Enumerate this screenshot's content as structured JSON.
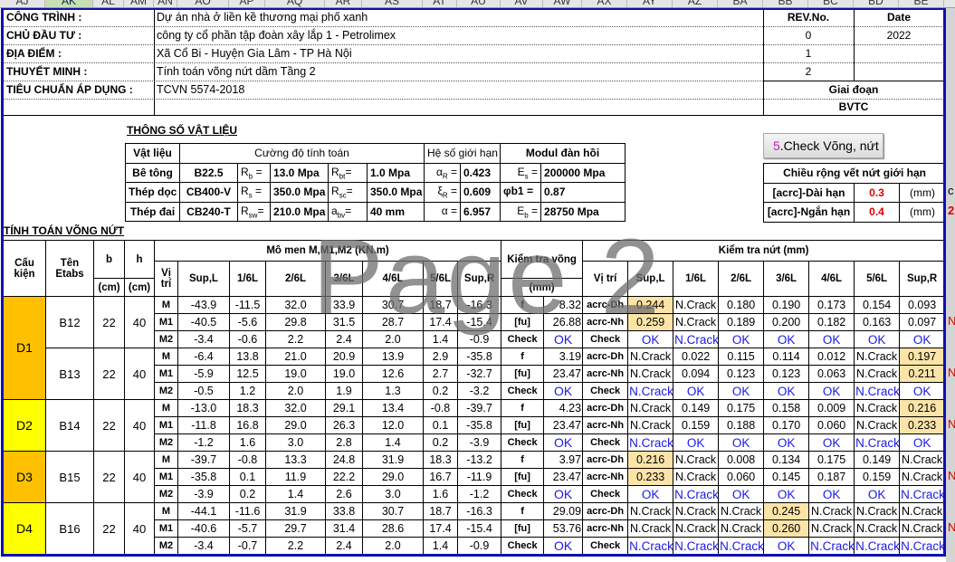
{
  "columns": [
    "AJ",
    "AK",
    "AL",
    "AM",
    "AN",
    "AO",
    "AP",
    "AQ",
    "AR",
    "AS",
    "AT",
    "AU",
    "AV",
    "AW",
    "AX",
    "AY",
    "AZ",
    "BA",
    "BB",
    "BC",
    "BD",
    "BE"
  ],
  "selected_column": "AK",
  "info": [
    {
      "label": "CÔNG TRÌNH :",
      "value": "Dự án nhà ở liền kề thương mại phố xanh"
    },
    {
      "label": "CHỦ ĐẦU TƯ :",
      "value": "công ty cổ phần tập đoàn xây lắp 1 - Petrolimex"
    },
    {
      "label": "ĐỊA ĐIỂM :",
      "value": "Xã Cổ Bi - Huyện Gia Lâm - TP Hà Nội"
    },
    {
      "label": "THUYẾT MINH :",
      "value": "Tính toán võng nứt dầm Tầng 2"
    },
    {
      "label": "TIÊU CHUẨN ÁP DỤNG :",
      "value": "TCVN 5574-2018"
    }
  ],
  "revision": {
    "rev_header": "REV.No.",
    "date_header": "Date",
    "rows": [
      {
        "rev": "0",
        "date": "2022"
      },
      {
        "rev": "1",
        "date": ""
      },
      {
        "rev": "2",
        "date": ""
      }
    ],
    "stage_label": "Giai đoạn",
    "stage_value": "BVTC"
  },
  "materials": {
    "title": "THÔNG SỐ VẬT LIỆU",
    "headers": {
      "material": "Vật liệu",
      "strength": "Cường độ tính toán",
      "limit": "Hệ số giới hạn",
      "modulus": "Modul đàn hồi"
    },
    "rows": [
      {
        "name": "Bê tông",
        "grade": "B22.5",
        "s1": "R",
        "s1sub": "b",
        "s1eq": " =",
        "v1": "13.0 Mpa",
        "s2": "R",
        "s2sub": "bt",
        "s2eq": "=",
        "v2": "1.0 Mpa",
        "k": "α",
        "ksub": "R",
        "keq": " =",
        "kv": "0.423",
        "e": "E",
        "esub": "s",
        "eeq": " =",
        "ev": "200000 Mpa"
      },
      {
        "name": "Thép  dọc",
        "grade": "CB400-V",
        "s1": "R",
        "s1sub": "s",
        "s1eq": " =",
        "v1": "350.0 Mpa",
        "s2": "R",
        "s2sub": "sc",
        "s2eq": "=",
        "v2": "350.0 Mpa",
        "k": "ξ",
        "ksub": "R",
        "keq": " =",
        "kv": "0.609",
        "e": "φb1 =",
        "esub": "",
        "eeq": "",
        "ev": "0.87"
      },
      {
        "name": "Thép đai",
        "grade": "CB240-T",
        "s1": "R",
        "s1sub": "sw",
        "s1eq": "=",
        "v1": "210.0 Mpa",
        "s2": "a",
        "s2sub": "bv",
        "s2eq": "=",
        "v2": "40 mm",
        "k": "α",
        "ksub": "",
        "keq": " =",
        "kv": "6.957",
        "e": "E",
        "esub": "b",
        "eeq": " =",
        "ev": "28750 Mpa"
      }
    ]
  },
  "check_button": {
    "number": "5",
    "label": ".Check Võng, nứt"
  },
  "crack_limit": {
    "title": "Chiều rộng vết nứt giới hạn",
    "rows": [
      {
        "label": "[acrc]-Dài hạn",
        "value": "0.3",
        "unit": "(mm)"
      },
      {
        "label": "[acrc]-Ngắn hạn",
        "value": "0.4",
        "unit": "(mm)"
      }
    ],
    "overflow": [
      "c",
      "2I"
    ]
  },
  "calc": {
    "title": "TÍNH TOÁN VÕNG NỨT",
    "headers": {
      "member": "Cấu kiện",
      "etabs": "Tên Etabs",
      "b": "b",
      "h": "h",
      "unit_cm": "(cm)",
      "moment": "Mô men M,M1,M2 (KN.m)",
      "position": "Vị trí",
      "deflection": "Kiểm tra võng",
      "unit_mm": "(mm)",
      "crack": "Kiểm tra nứt (mm)",
      "crack_position": "Vị trí",
      "stations": [
        "Sup,L",
        "1/6L",
        "2/6L",
        "3/6L",
        "4/6L",
        "5/6L",
        "Sup,R"
      ]
    },
    "moment_rows": [
      "M",
      "M1",
      "M2"
    ],
    "deflection_labels": [
      "f",
      "[fu]",
      "Check"
    ],
    "crack_rows": [
      "acrc-Dh",
      "acrc-Nh",
      "Check"
    ],
    "overflow_mark": "N",
    "members": [
      {
        "member": "D1",
        "color": "#ffc000",
        "beams": [
          {
            "name": "B12",
            "b": "22",
            "h": "40",
            "moments": [
              [
                "-43.9",
                "-11.5",
                "32.0",
                "33.9",
                "30.7",
                "18.7",
                "-16.3"
              ],
              [
                "-40.5",
                "-5.6",
                "29.8",
                "31.5",
                "28.7",
                "17.4",
                "-15.4"
              ],
              [
                "-3.4",
                "-0.6",
                "2.2",
                "2.4",
                "2.0",
                "1.4",
                "-0.9"
              ]
            ],
            "deflection": [
              "8.32",
              "26.88",
              "OK"
            ],
            "crack": [
              [
                "0.244",
                "N.Crack",
                "0.180",
                "0.190",
                "0.173",
                "0.154",
                "0.093"
              ],
              [
                "0.259",
                "N.Crack",
                "0.189",
                "0.200",
                "0.182",
                "0.163",
                "0.097"
              ],
              [
                "OK",
                "N.Crack",
                "OK",
                "OK",
                "OK",
                "OK",
                "OK"
              ]
            ],
            "highlight": [
              0
            ]
          },
          {
            "name": "B13",
            "b": "22",
            "h": "40",
            "moments": [
              [
                "-6.4",
                "13.8",
                "21.0",
                "20.9",
                "13.9",
                "2.9",
                "-35.8"
              ],
              [
                "-5.9",
                "12.5",
                "19.0",
                "19.0",
                "12.6",
                "2.7",
                "-32.7"
              ],
              [
                "-0.5",
                "1.2",
                "2.0",
                "1.9",
                "1.3",
                "0.2",
                "-3.2"
              ]
            ],
            "deflection": [
              "3.19",
              "23.47",
              "OK"
            ],
            "crack": [
              [
                "N.Crack",
                "0.022",
                "0.115",
                "0.114",
                "0.012",
                "N.Crack",
                "0.197"
              ],
              [
                "N.Crack",
                "0.094",
                "0.123",
                "0.123",
                "0.063",
                "N.Crack",
                "0.211"
              ],
              [
                "N.Crack",
                "OK",
                "OK",
                "OK",
                "OK",
                "N.Crack",
                "OK"
              ]
            ],
            "highlight": [
              6
            ]
          }
        ]
      },
      {
        "member": "D2",
        "color": "#ffff00",
        "beams": [
          {
            "name": "B14",
            "b": "22",
            "h": "40",
            "moments": [
              [
                "-13.0",
                "18.3",
                "32.0",
                "29.1",
                "13.4",
                "-0.8",
                "-39.7"
              ],
              [
                "-11.8",
                "16.8",
                "29.0",
                "26.3",
                "12.0",
                "0.1",
                "-35.8"
              ],
              [
                "-1.2",
                "1.6",
                "3.0",
                "2.8",
                "1.4",
                "0.2",
                "-3.9"
              ]
            ],
            "deflection": [
              "4.23",
              "23.47",
              "OK"
            ],
            "crack": [
              [
                "N.Crack",
                "0.149",
                "0.175",
                "0.158",
                "0.009",
                "N.Crack",
                "0.216"
              ],
              [
                "N.Crack",
                "0.159",
                "0.188",
                "0.170",
                "0.060",
                "N.Crack",
                "0.233"
              ],
              [
                "N.Crack",
                "OK",
                "OK",
                "OK",
                "OK",
                "N.Crack",
                "OK"
              ]
            ],
            "highlight": [
              6
            ]
          }
        ]
      },
      {
        "member": "D3",
        "color": "#ffc000",
        "beams": [
          {
            "name": "B15",
            "b": "22",
            "h": "40",
            "moments": [
              [
                "-39.7",
                "-0.8",
                "13.3",
                "24.8",
                "31.9",
                "18.3",
                "-13.2"
              ],
              [
                "-35.8",
                "0.1",
                "11.9",
                "22.2",
                "29.0",
                "16.7",
                "-11.9"
              ],
              [
                "-3.9",
                "0.2",
                "1.4",
                "2.6",
                "3.0",
                "1.6",
                "-1.2"
              ]
            ],
            "deflection": [
              "3.97",
              "23.47",
              "OK"
            ],
            "crack": [
              [
                "0.216",
                "N.Crack",
                "0.008",
                "0.134",
                "0.175",
                "0.149",
                "N.Crack"
              ],
              [
                "0.233",
                "N.Crack",
                "0.060",
                "0.145",
                "0.187",
                "0.159",
                "N.Crack"
              ],
              [
                "OK",
                "N.Crack",
                "OK",
                "OK",
                "OK",
                "OK",
                "N.Crack"
              ]
            ],
            "highlight": [
              0
            ]
          }
        ]
      },
      {
        "member": "D4",
        "color": "#ffff00",
        "beams": [
          {
            "name": "B16",
            "b": "22",
            "h": "40",
            "moments": [
              [
                "-44.1",
                "-11.6",
                "31.9",
                "33.8",
                "30.7",
                "18.7",
                "-16.3"
              ],
              [
                "-40.6",
                "-5.7",
                "29.7",
                "31.4",
                "28.6",
                "17.4",
                "-15.4"
              ],
              [
                "-3.4",
                "-0.7",
                "2.2",
                "2.4",
                "2.0",
                "1.4",
                "-0.9"
              ]
            ],
            "deflection": [
              "29.09",
              "53.76",
              "OK"
            ],
            "crack": [
              [
                "N.Crack",
                "N.Crack",
                "N.Crack",
                "0.245",
                "N.Crack",
                "N.Crack",
                "N.Crack"
              ],
              [
                "N.Crack",
                "N.Crack",
                "N.Crack",
                "0.260",
                "N.Crack",
                "N.Crack",
                "N.Crack"
              ],
              [
                "N.Crack",
                "N.Crack",
                "N.Crack",
                "OK",
                "N.Crack",
                "N.Crack",
                "N.Crack"
              ]
            ],
            "highlight": [
              3
            ]
          }
        ]
      }
    ]
  },
  "watermark": "Page 2",
  "colors": {
    "frame": "#1010b0",
    "ok_text": "#1a1ae6",
    "limit_value": "#e00000",
    "highlight": "#fce4a8",
    "member_orange": "#ffc000",
    "member_yellow": "#ffff00",
    "button_number": "#c020c0"
  }
}
